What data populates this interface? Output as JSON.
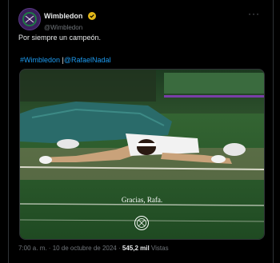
{
  "post": {
    "display_name": "Wimbledon",
    "handle": "@Wimbledon",
    "text": "Por siempre un campeón.",
    "hashtag1": "#Wimbledon",
    "separator": " |",
    "hashtag2": "@RafaelNadal",
    "media_caption": "Gracias, Rafa.",
    "time": "7:00 a. m.",
    "dot": " · ",
    "date": "10 de octubre de 2024",
    "views_count": "545,2 mil",
    "views_label": "Vistas"
  },
  "icons": {
    "avatar": "wimbledon-logo",
    "verified": "verified-badge-icon",
    "more": "more-options-icon"
  },
  "colors": {
    "accent": "#1d9bf0",
    "verified": "#e2b719",
    "brand_purple": "#54008b",
    "grass": "#3f7a3a"
  }
}
